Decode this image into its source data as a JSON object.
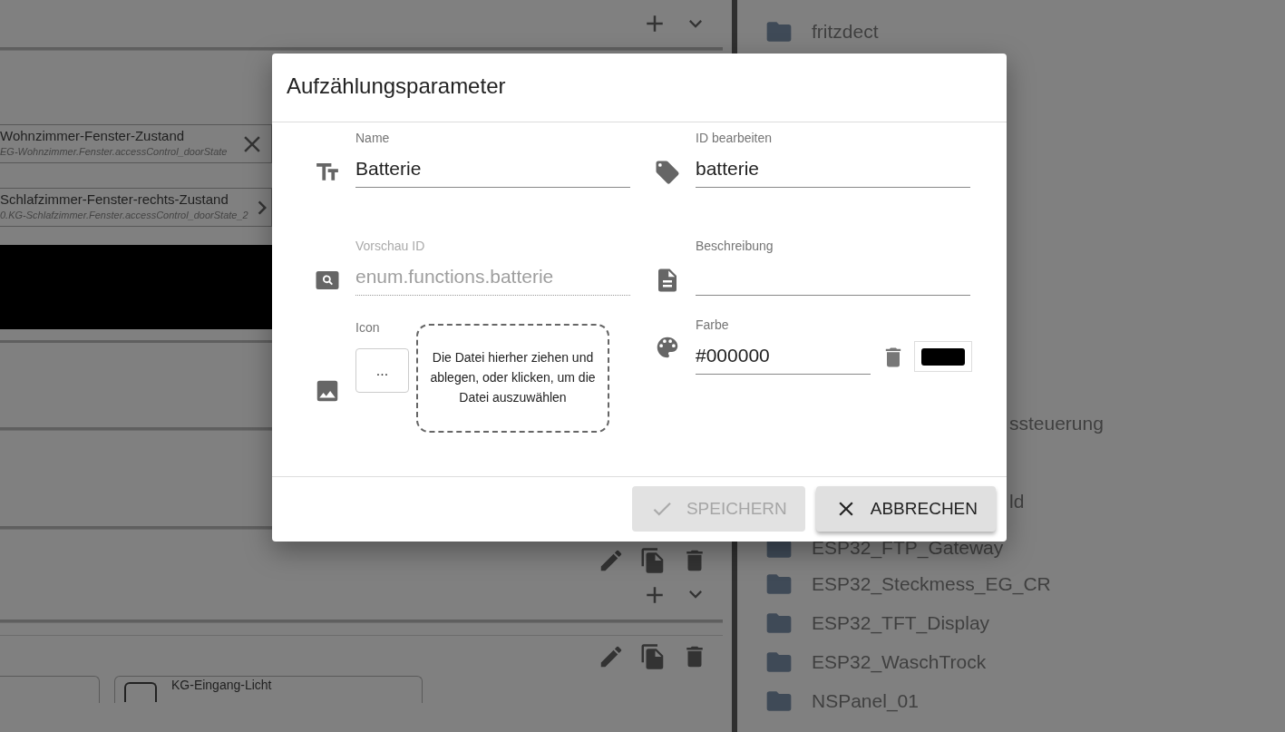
{
  "background": {
    "chips": [
      {
        "title": "Wohnzimmer-Fenster-Zustand",
        "subtitle": "EG-Wohnzimmer.Fenster.accessControl_doorState",
        "kind": "close"
      },
      {
        "title": "Schlafzimmer-Fenster-rechts-Zustand",
        "subtitle": "0.KG-Schlafzimmer.Fenster.accessControl_doorState_2",
        "kind": "arrow"
      }
    ],
    "bottom_chip": "KG-Eingang-Licht",
    "folders": [
      {
        "kind": "folder",
        "label": "fritzdect"
      },
      {
        "kind": "cut",
        "label": "ssteuerung"
      },
      {
        "kind": "cut",
        "label": "ld"
      },
      {
        "kind": "folder",
        "label": "ESP32_FTP_Gateway"
      },
      {
        "kind": "folder",
        "label": "ESP32_Steckmess_EG_CR"
      },
      {
        "kind": "folder",
        "label": "ESP32_TFT_Display"
      },
      {
        "kind": "folder",
        "label": "ESP32_WaschTrock"
      },
      {
        "kind": "folder",
        "label": "NSPanel_01"
      }
    ]
  },
  "dialog": {
    "title": "Aufzählungsparameter",
    "fields": [
      {
        "kind": "text",
        "label": "Name",
        "value": "Batterie",
        "disabled": false
      },
      {
        "kind": "tag",
        "label": "ID bearbeiten",
        "value": "batterie",
        "disabled": false
      },
      {
        "kind": "search",
        "label": "Vorschau ID",
        "value": "enum.functions.batterie",
        "disabled": true
      },
      {
        "kind": "description",
        "label": "Beschreibung",
        "disabled": false
      }
    ],
    "icon_field": {
      "label": "Icon",
      "button_label": "...",
      "dropzone_text": "Die Datei hierher ziehen und ablegen, oder klicken, um die Datei auszuwählen"
    },
    "color_field": {
      "label": "Farbe",
      "value": "#000000",
      "color": "#000000"
    },
    "buttons": [
      {
        "kind": "save",
        "label": "SPEICHERN",
        "disabled": true
      },
      {
        "kind": "cancel",
        "label": "ABBRECHEN",
        "disabled": false
      }
    ]
  }
}
